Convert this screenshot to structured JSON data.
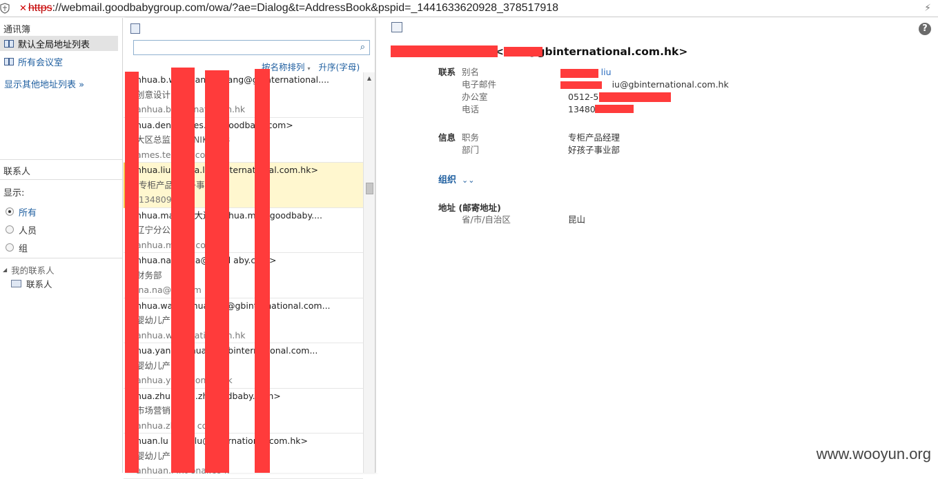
{
  "address_bar": {
    "protocol": "https",
    "url_rest": "://webmail.goodbabygroup.com/owa/?ae=Dialog&t=AddressBook&pspid=_1441633620928_378517918"
  },
  "nav": {
    "header": "通讯簿",
    "items": [
      {
        "label": "默认全局地址列表",
        "selected": true
      },
      {
        "label": "所有会议室",
        "selected": false
      }
    ],
    "more_label": "显示其他地址列表",
    "contacts_header": "联系人",
    "show_label": "显示:",
    "filters": [
      {
        "label": "所有",
        "checked": true
      },
      {
        "label": "人员",
        "checked": false
      },
      {
        "label": "组",
        "checked": false
      }
    ],
    "tree_parent": "我的联系人",
    "tree_child": "联系人"
  },
  "list": {
    "search_placeholder": "",
    "sort_by": "按名称排列",
    "sort_order": "升序(字母)",
    "entries": [
      {
        "line1": "nhua.b.wa    建     anhua.   ang@gbinternational....",
        "line2": "创意设计         市",
        "line3": "anhua.b.      @g   nation   m.hk"
      },
      {
        "line1": "hua.den      华     mes.ten   goodbaby.com>",
        "line2": "大区总监      上海   NIKE事   3",
        "line3": "ames.ten      oo        .com"
      },
      {
        "line1": "nhua.liu    ...    <      a.liu@g    ternational.com.hk>",
        "line2": "专柜产品      好     子事业部",
        "line3": "1348090     8",
        "selected": true
      },
      {
        "line1": "nhua.ma         华   (   大连)  anhua.ma@goodbaby....",
        "line2": "辽宁分公司",
        "line3": "anhua.m      ood     com"
      },
      {
        "line1": "nhua.na  美       <      a@good  aby.com>",
        "line2": "财务部",
        "line3": "ina.na@g       ab     m"
      },
      {
        "line1": "nhua.wan      华      hua.wa    @gbinternational.com...",
        "line2": "婴幼儿产",
        "line3": "anhua.wa     gb     ational     n.hk"
      },
      {
        "line1": "hua.yang     华      hua.ya    gbinternational.com...",
        "line2": "婴幼儿产",
        "line3": "anhua.ya     bi     tional.     .hk"
      },
      {
        "line1": "hua.zhu      华     ua.zhu    oodbaby.com>",
        "line2": "市场营销",
        "line3": "anhua.zh       ood     com"
      },
      {
        "line1": "huan.lu          <      an.lu@g    ternational.com.hk>",
        "line2": "婴幼儿产",
        "line3": "anhuan.l      int     onal.co   k"
      }
    ]
  },
  "detail": {
    "title": "<      .liu@gbinternational.com.hk>",
    "contact": {
      "heading": "联系",
      "rows": [
        {
          "key": "别名",
          "value": "            liu",
          "link": true
        },
        {
          "key": "电子邮件",
          "value": "                iu@gbinternational.com.hk"
        },
        {
          "key": "办公室",
          "value": "0512-57"
        },
        {
          "key": "电话",
          "value": "134809"
        }
      ]
    },
    "info": {
      "heading": "信息",
      "rows": [
        {
          "key": "职务",
          "value": "专柜产品经理"
        },
        {
          "key": "部门",
          "value": "好孩子事业部"
        }
      ]
    },
    "org_label": "组织",
    "address_heading": "地址 (邮寄地址)",
    "address_rows": [
      {
        "key": "省/市/自治区",
        "value": "昆山"
      }
    ],
    "watermark": "www.wooyun.org"
  },
  "colors": {
    "redaction": "#ff3b3b",
    "link": "#1f5fa0",
    "selected_row": "#fff7cf"
  }
}
